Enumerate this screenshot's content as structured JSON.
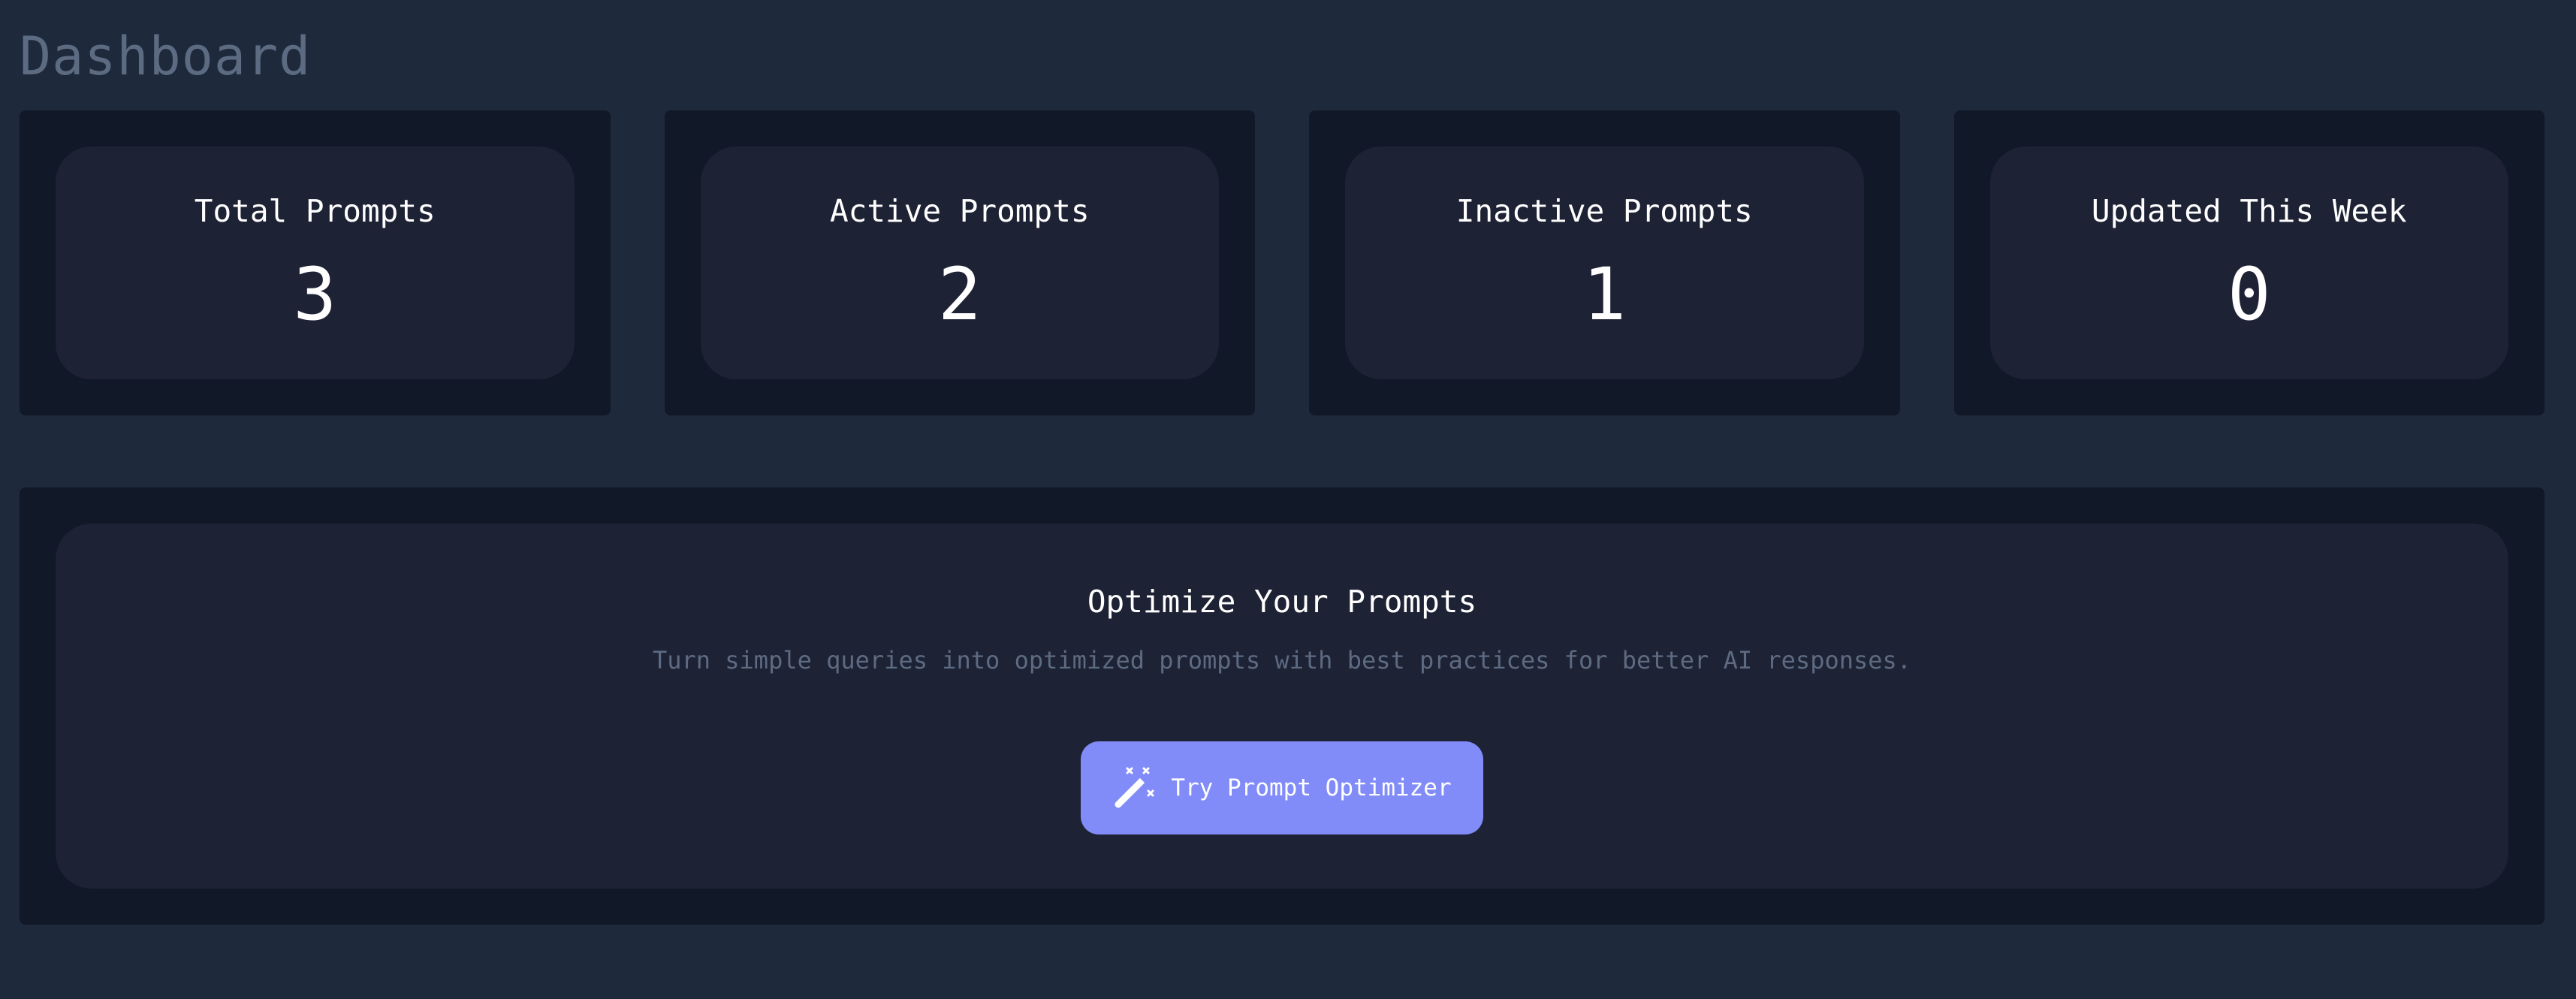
{
  "page": {
    "title": "Dashboard"
  },
  "stats": [
    {
      "label": "Total Prompts",
      "value": "3"
    },
    {
      "label": "Active Prompts",
      "value": "2"
    },
    {
      "label": "Inactive Prompts",
      "value": "1"
    },
    {
      "label": "Updated This Week",
      "value": "0"
    }
  ],
  "optimizer": {
    "title": "Optimize Your Prompts",
    "description": "Turn simple queries into optimized prompts with best practices for better AI responses.",
    "button_label": "Try Prompt Optimizer",
    "button_icon": "magic-wand-icon"
  },
  "colors": {
    "background": "#1e293b",
    "panel": "#111827",
    "card": "#1e2235",
    "accent": "#818cf8",
    "muted_text": "#5d6b82",
    "text": "#ffffff"
  }
}
